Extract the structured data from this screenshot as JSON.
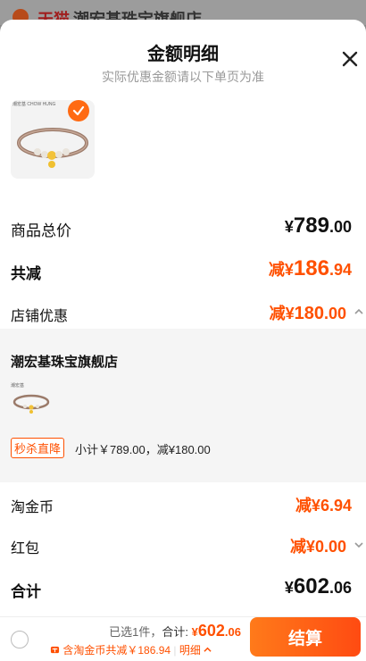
{
  "background": {
    "tag": "天猫",
    "store_title": "潮宏基珠宝旗舰店"
  },
  "sheet": {
    "title": "金额明细",
    "subtitle": "实际优惠金额请以下单页为准"
  },
  "product": {
    "thumb_brand": "潮宏基\nCHOW HUNG"
  },
  "summary": {
    "total_label": "商品总价",
    "total_symbol": "¥",
    "total_int": "789",
    "total_dec": ".00",
    "reduce_label": "共减",
    "reduce_prefix": "减¥",
    "reduce_int": "186",
    "reduce_dec": ".94",
    "store_discount_label": "店铺优惠",
    "store_discount_prefix": "减¥",
    "store_discount_int": "180",
    "store_discount_dec": ".00"
  },
  "store": {
    "name": "潮宏基珠宝旗舰店",
    "thumb_brand": "潮宏基",
    "promo_tag": "秒杀直降",
    "promo_text": "小计￥789.00，减¥180.00"
  },
  "coins": {
    "label": "淘金币",
    "prefix": "减¥",
    "value": "6.94"
  },
  "redpacket": {
    "label": "红包",
    "prefix": "减¥",
    "value": "0.00"
  },
  "grand": {
    "label": "合计",
    "symbol": "¥",
    "int": "602",
    "dec": ".06"
  },
  "bottom": {
    "selected": "已选1件，",
    "total_label": "合计:",
    "total_symbol": "¥",
    "total_int": "602",
    "total_dec": ".06",
    "savings": "含淘金币共减￥186.94",
    "detail": "明细",
    "checkout": "结算"
  },
  "colors": {
    "accent": "#ff5000",
    "checkout_start": "#ff7a1a",
    "checkout_end": "#ff4b12"
  },
  "icons": {
    "close": "close-icon",
    "check": "check-icon",
    "chevron_up": "chevron-up-icon",
    "chevron_down": "chevron-down-icon",
    "coin": "coin-icon"
  }
}
